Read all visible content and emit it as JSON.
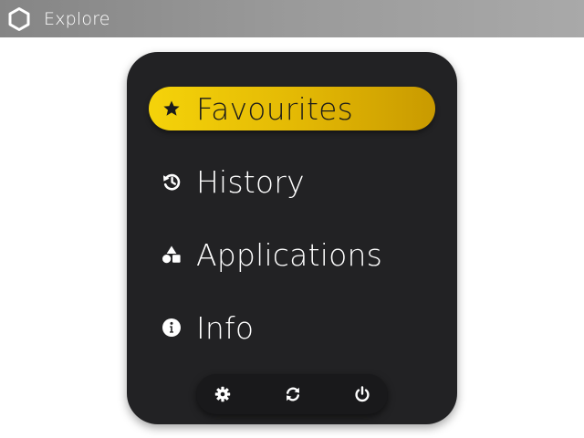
{
  "window": {
    "title": "Explore",
    "icon": "hexagon-icon"
  },
  "menu": {
    "items": [
      {
        "label": "Favourites",
        "icon": "star-icon",
        "active": true
      },
      {
        "label": "History",
        "icon": "history-icon",
        "active": false
      },
      {
        "label": "Applications",
        "icon": "shapes-icon",
        "active": false
      },
      {
        "label": "Info",
        "icon": "info-icon",
        "active": false
      }
    ]
  },
  "toolbar": {
    "buttons": [
      {
        "icon": "gear-icon"
      },
      {
        "icon": "refresh-icon"
      },
      {
        "icon": "power-icon"
      }
    ]
  },
  "colors": {
    "titlebar": "#9a9a9a",
    "panel": "#222224",
    "accent": "#e8c006",
    "toolbar": "#19191b",
    "text": "#ffffff"
  }
}
